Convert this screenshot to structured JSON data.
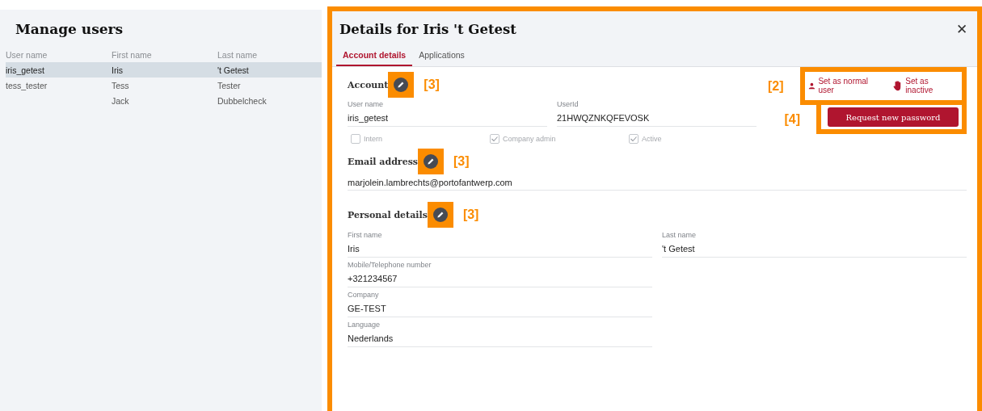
{
  "page": {
    "title": "Manage users"
  },
  "users_table": {
    "columns": [
      "User name",
      "First name",
      "Last name"
    ],
    "rows": [
      {
        "user_name": "iris_getest",
        "first_name": "Iris",
        "last_name": "'t Getest",
        "selected": true
      },
      {
        "user_name": "tess_tester",
        "first_name": "Tess",
        "last_name": "Tester",
        "selected": false
      },
      {
        "first_name": "Jack",
        "last_name": "Dubbelcheck",
        "selected": false
      }
    ]
  },
  "details": {
    "title": "Details for Iris 't Getest",
    "close": "✕",
    "tabs": [
      {
        "label": "Account details",
        "selected": true
      },
      {
        "label": "Applications",
        "selected": false
      }
    ],
    "account": {
      "title": "Account",
      "annotation": "[3]",
      "fields": [
        {
          "label": "User name",
          "value": "iris_getest"
        },
        {
          "label": "UserId",
          "value": "21HWQZNKQFEVOSK"
        }
      ],
      "checkboxes": [
        {
          "label": "Intern",
          "checked": false
        },
        {
          "label": "Company admin",
          "checked": true
        },
        {
          "label": "Active",
          "checked": true
        }
      ]
    },
    "actions": {
      "annotation": "[2]",
      "links": [
        {
          "label": "Set as normal user",
          "kind": "user"
        },
        {
          "label": "Set as inactive",
          "kind": "hand"
        }
      ]
    },
    "password": {
      "annotation": "[4]",
      "button": "Request new password"
    },
    "email": {
      "title": "Email address",
      "annotation": "[3]",
      "value": "marjolein.lambrechts@portofantwerp.com"
    },
    "personal": {
      "title": "Personal details",
      "annotation": "[3]",
      "rows": [
        [
          {
            "label": "First name",
            "value": "Iris"
          },
          {
            "label": "Last name",
            "value": "'t Getest"
          }
        ],
        [
          {
            "label": "Mobile/Telephone number",
            "value": "+321234567"
          }
        ],
        [
          {
            "label": "Company",
            "value": "GE-TEST"
          }
        ],
        [
          {
            "label": "Language",
            "value": "Nederlands"
          }
        ]
      ]
    }
  }
}
